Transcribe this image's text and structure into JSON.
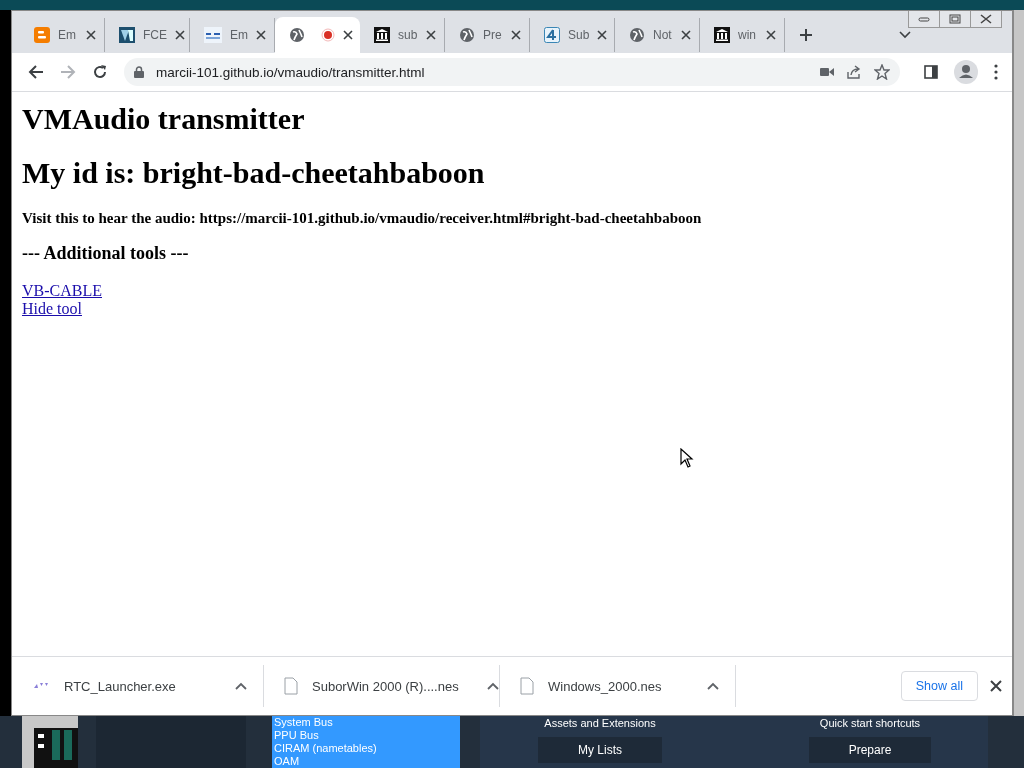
{
  "tabs": [
    {
      "kind": "blogger",
      "title": "Em",
      "selected": false
    },
    {
      "kind": "vlogo",
      "title": "FCE",
      "selected": false
    },
    {
      "kind": "er",
      "title": "Em",
      "selected": false
    },
    {
      "kind": "globe",
      "recording": true,
      "selected": true
    },
    {
      "kind": "museum",
      "title": "sub",
      "selected": false
    },
    {
      "kind": "globe",
      "title": "Pre",
      "selected": false
    },
    {
      "kind": "four",
      "title": "Sub",
      "selected": false
    },
    {
      "kind": "globe",
      "title": "Not",
      "selected": false
    },
    {
      "kind": "museum",
      "title": "win",
      "selected": false
    }
  ],
  "address_bar": {
    "url": "marcii-101.github.io/vmaudio/transmitter.html"
  },
  "page": {
    "title": "VMAudio transmitter",
    "id_heading": "My id is: bright-bad-cheetahbaboon",
    "visit_text": "Visit this to hear the audio: https://marcii-101.github.io/vmaudio/receiver.html#bright-bad-cheetahbaboon",
    "tools_heading": "--- Additional tools ---",
    "links": [
      "VB-CABLE",
      "Hide tool"
    ]
  },
  "downloads": [
    {
      "kind": "app",
      "name": "RTC_Launcher.exe"
    },
    {
      "kind": "file",
      "name": "SuborWin 2000 (R)....nes"
    },
    {
      "kind": "file",
      "name": "Windows_2000.nes"
    }
  ],
  "show_all": "Show all",
  "background": {
    "memory_list": [
      "System Bus",
      "PPU Bus",
      "CIRAM (nametables)",
      "OAM"
    ],
    "section_labels": [
      "Assets and Extensions",
      "Quick start shortcuts"
    ],
    "buttons": [
      "My Lists",
      "Prepare"
    ]
  }
}
